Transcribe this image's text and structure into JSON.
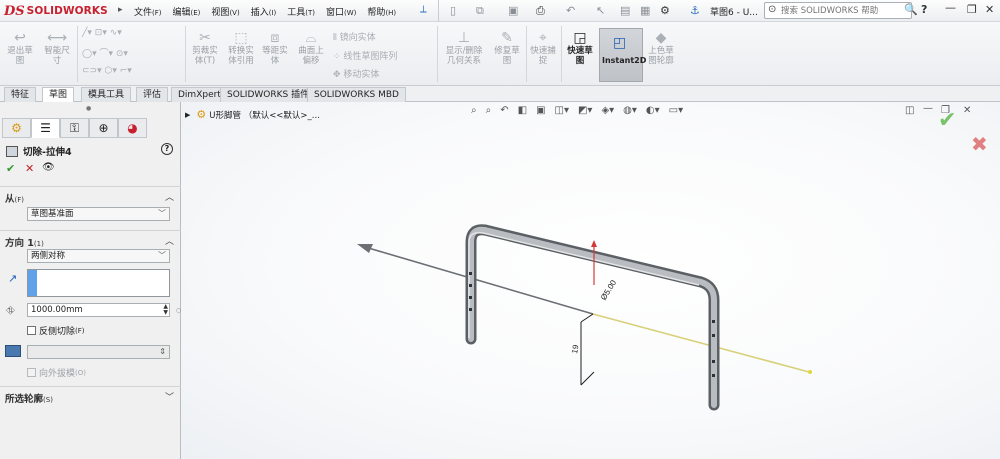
{
  "app": {
    "logo_mark": "DS",
    "logo_text": "SOLIDWORKS",
    "doc_title": "草图6 - U...",
    "search_placeholder": "搜索 SOLIDWORKS 帮助"
  },
  "menus": [
    {
      "label": "文件",
      "key": "(F)"
    },
    {
      "label": "编辑",
      "key": "(E)"
    },
    {
      "label": "视图",
      "key": "(V)"
    },
    {
      "label": "插入",
      "key": "(I)"
    },
    {
      "label": "工具",
      "key": "(T)"
    },
    {
      "label": "窗口",
      "key": "(W)"
    },
    {
      "label": "帮助",
      "key": "(H)"
    }
  ],
  "ribbon": {
    "exit_sketch": "退出草\n图",
    "smart_dim": "智能尺\n寸",
    "trim": "剪裁实\n体(T)",
    "convert": "转换实\n体引用",
    "offset": "等距实\n体",
    "surface_offset": "曲面上\n偏移",
    "mirror": "镜向实体",
    "linear_pattern": "线性草图阵列",
    "move": "移动实体",
    "display_relations": "显示/删除\n几何关系",
    "repair": "修复草\n图",
    "quick_snap": "快速捕\n捉",
    "rapid_sketch": "快速草\n图",
    "instant2d": "Instant2D",
    "shaded_contours": "上色草\n图轮廓"
  },
  "tabs": [
    {
      "label": "特征",
      "active": false
    },
    {
      "label": "草图",
      "active": true
    },
    {
      "label": "模具工具",
      "active": false
    },
    {
      "label": "评估",
      "active": false
    },
    {
      "label": "DimXpert",
      "active": false
    },
    {
      "label": "SOLIDWORKS 插件",
      "active": false
    },
    {
      "label": "SOLIDWORKS MBD",
      "active": false
    }
  ],
  "panel": {
    "title": "切除-拉伸4",
    "from_label": "从",
    "from_key": "(F)",
    "from_value": "草图基准面",
    "direction_label": "方向 1",
    "direction_key": "(1)",
    "direction_value": "两侧对称",
    "depth_value": "1000.00mm",
    "flip_side_label": "反侧切除",
    "flip_side_key": "(F)",
    "draft_outward_label": "向外拔模",
    "draft_outward_key": "(O)",
    "selected_contours_label": "所选轮廓",
    "selected_contours_key": "(S)"
  },
  "viewport": {
    "tree_label": "U形脚管 （默认<<默认>_..."
  },
  "dimension_text": "Ø5.00"
}
